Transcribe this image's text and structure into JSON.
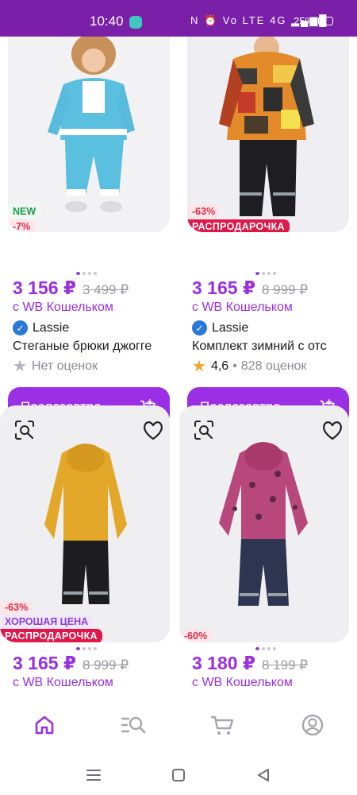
{
  "status_bar": {
    "time": "10:40",
    "sys_icons": "N ⏰ Vo LTE 4G ▂▄▆█",
    "battery": "25%"
  },
  "products": [
    {
      "badges": [
        "NEW",
        "-7%"
      ],
      "price": "3 156 ₽",
      "old_price": "3 499 ₽",
      "wallet": "с WB Кошельком",
      "brand": "Lassie",
      "title": "Стеганые брюки джогге",
      "rating": "Нет оценок",
      "button": "Послезавтра"
    },
    {
      "badges": [
        "-63%",
        "РАСПРОДАРОЧКА"
      ],
      "price": "3 165 ₽",
      "old_price": "8 999 ₽",
      "wallet": "с WB Кошельком",
      "brand": "Lassie",
      "title": "Комплект зимний с отс",
      "rating_value": "4,6",
      "rating_count": "828 оценок",
      "button": "Послезавтра"
    },
    {
      "badges": [
        "-63%",
        "ХОРОШАЯ ЦЕНА",
        "РАСПРОДАРОЧКА"
      ],
      "price": "3 165 ₽",
      "old_price": "8 999 ₽",
      "wallet": "с WB Кошельком"
    },
    {
      "badges": [
        "-60%"
      ],
      "price": "3 180 ₽",
      "old_price": "8 199 ₽",
      "wallet": "с WB Кошельком"
    }
  ],
  "colors": {
    "accent": "#9b2fe6",
    "status_bar": "#7a1fa8",
    "sale": "#e0184a"
  },
  "icons": [
    "search-by-photo-icon",
    "heart-icon",
    "cart-icon",
    "home-icon",
    "catalog-search-icon",
    "profile-icon"
  ]
}
